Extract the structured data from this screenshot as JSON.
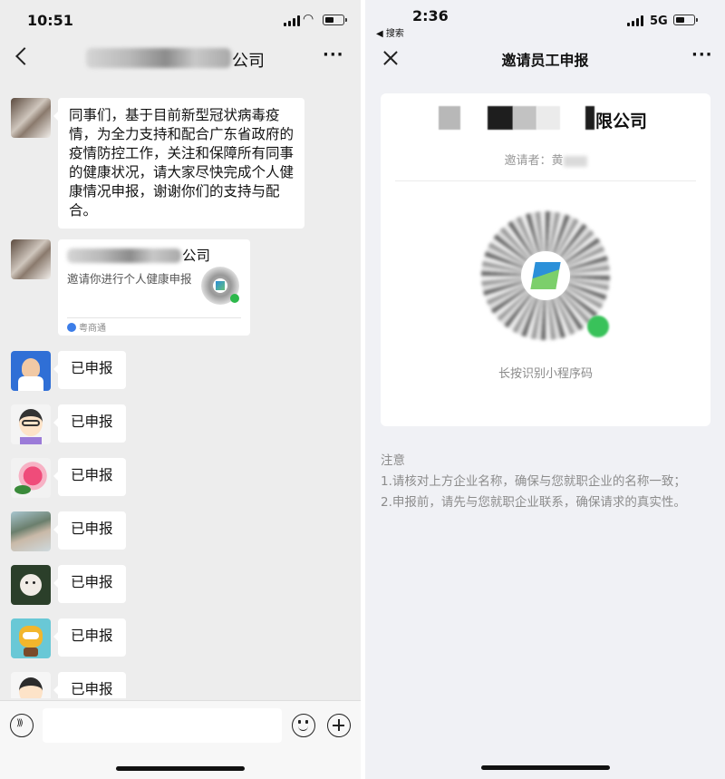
{
  "left_phone": {
    "status_time": "10:51",
    "chat_title_suffix": "公司",
    "messages": [
      {
        "type": "text",
        "text": "同事们，基于目前新型冠状病毒疫情，为全力支持和配合广东省政府的疫情防控工作，关注和保障所有同事的健康状况，请大家尽快完成个人健康情况申报，谢谢你们的支持与配合。"
      },
      {
        "type": "card",
        "title_suffix": "公司",
        "description": "邀请你进行个人健康申报",
        "footer": "粤商通"
      },
      {
        "type": "text",
        "text": "已申报"
      },
      {
        "type": "text",
        "text": "已申报"
      },
      {
        "type": "text",
        "text": "已申报"
      },
      {
        "type": "text",
        "text": "已申报"
      },
      {
        "type": "text",
        "text": "已申报"
      },
      {
        "type": "text",
        "text": "已申报"
      },
      {
        "type": "text",
        "text": "已申报"
      }
    ]
  },
  "right_phone": {
    "status_time": "2:36",
    "back_label": "◀ 搜索",
    "network": "5G",
    "nav_title": "邀请员工申报",
    "company_suffix": "限公司",
    "inviter_label": "邀请者：黄",
    "qr_hint": "长按识别小程序码",
    "notes": {
      "heading": "注意",
      "items": [
        "1.请核对上方企业名称，确保与您就职企业的名称一致；",
        "2.申报前，请先与您就职企业联系，确保请求的真实性。"
      ]
    }
  },
  "colors": {
    "chat_bg": "#ededed",
    "bubble_bg": "#ffffff",
    "page_bg": "#f0f1f5",
    "accent_green": "#39c25a"
  }
}
